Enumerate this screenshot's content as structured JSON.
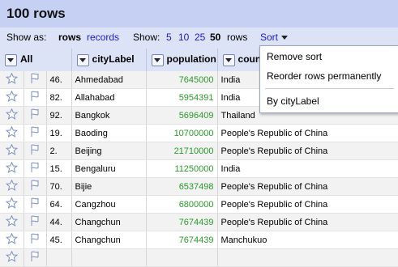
{
  "title": "100 rows",
  "viewbar": {
    "show_as_label": "Show as:",
    "rows_mode": "rows",
    "records_mode": "records",
    "show_label": "Show:",
    "page_sizes": [
      "5",
      "10",
      "25",
      "50"
    ],
    "rows_suffix": "rows",
    "sort_label": "Sort"
  },
  "columns": {
    "all": "All",
    "cityLabel": "cityLabel",
    "population": "population",
    "country": "coun"
  },
  "rows": [
    {
      "index": "46.",
      "city": "Ahmedabad",
      "population": "7645000",
      "country": "India"
    },
    {
      "index": "82.",
      "city": "Allahabad",
      "population": "5954391",
      "country": "India"
    },
    {
      "index": "92.",
      "city": "Bangkok",
      "population": "5696409",
      "country": "Thailand"
    },
    {
      "index": "19.",
      "city": "Baoding",
      "population": "10700000",
      "country": "People's Republic of China"
    },
    {
      "index": "2.",
      "city": "Beijing",
      "population": "21710000",
      "country": "People's Republic of China"
    },
    {
      "index": "15.",
      "city": "Bengaluru",
      "population": "11250000",
      "country": "India"
    },
    {
      "index": "70.",
      "city": "Bijie",
      "population": "6537498",
      "country": "People's Republic of China"
    },
    {
      "index": "64.",
      "city": "Cangzhou",
      "population": "6800000",
      "country": "People's Republic of China"
    },
    {
      "index": "44.",
      "city": "Changchun",
      "population": "7674439",
      "country": "People's Republic of China"
    },
    {
      "index": "45.",
      "city": "Changchun",
      "population": "7674439",
      "country": "Manchukuo"
    },
    {
      "index": "",
      "city": "",
      "population": "",
      "country": ""
    }
  ],
  "sort_menu": {
    "remove_sort": "Remove sort",
    "reorder": "Reorder rows permanently",
    "by_city": "By cityLabel"
  },
  "colors": {
    "title_bg": "#c6d0f3",
    "bar_bg": "#dde3f7",
    "link": "#1a1ad0",
    "number": "#2a9a2a"
  },
  "icons": {
    "star": "star-icon",
    "flag": "flag-icon"
  }
}
